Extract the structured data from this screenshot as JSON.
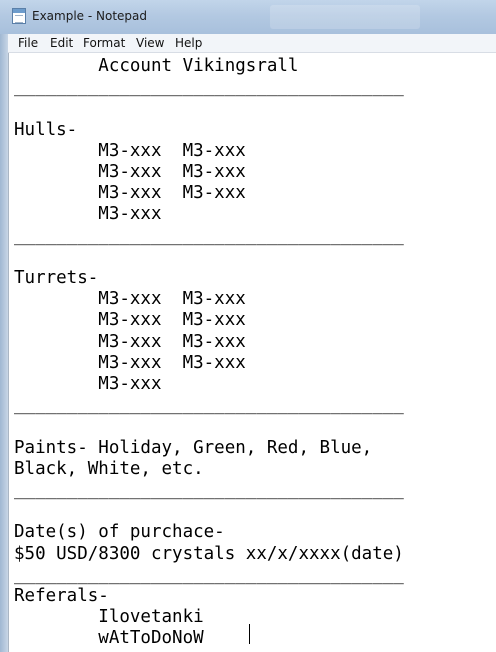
{
  "window": {
    "title": "Example - Notepad",
    "icon": "notepad-icon"
  },
  "menu": {
    "items": [
      "File",
      "Edit",
      "Format",
      "View",
      "Help"
    ]
  },
  "document": {
    "text": "        Account Vikingsrall\n_____________________________________\n\nHulls-\n        M3-xxx  M3-xxx\n        M3-xxx  M3-xxx\n        M3-xxx  M3-xxx\n        M3-xxx\n_____________________________________\n\nTurrets-\n        M3-xxx  M3-xxx\n        M3-xxx  M3-xxx\n        M3-xxx  M3-xxx\n        M3-xxx  M3-xxx\n        M3-xxx\n_____________________________________\n\nPaints- Holiday, Green, Red, Blue,\nBlack, White, etc.\n_____________________________________\n\nDate(s) of purchace-\n$50 USD/8300 crystals xx/x/xxxx(date)\n_____________________________________\nReferals-\n        Ilovetanki\n        wAtToDoNoW"
  }
}
